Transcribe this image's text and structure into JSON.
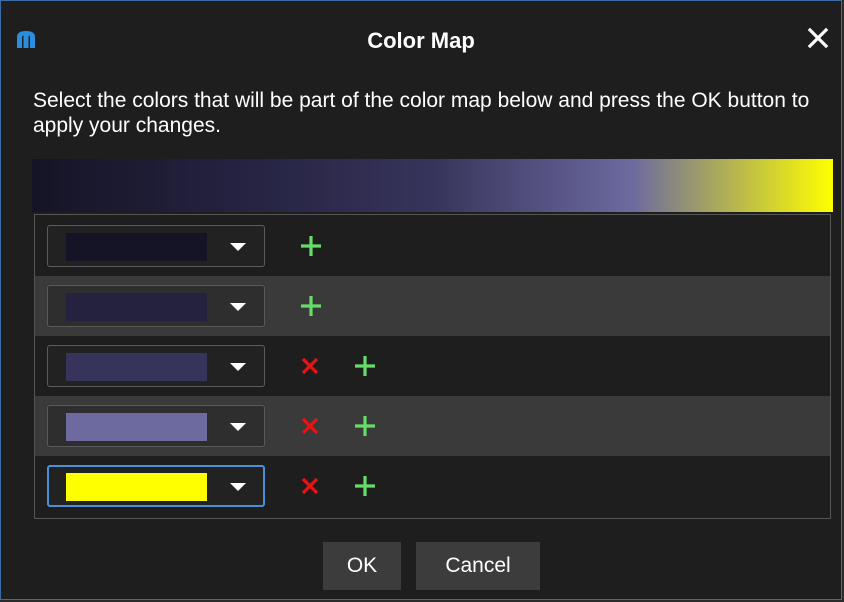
{
  "dialog": {
    "title": "Color Map",
    "app_icon": "app-logo-icon",
    "close_icon": "close-icon",
    "description": "Select the colors that will be part of the color map below and press the OK button to apply your changes."
  },
  "colors": {
    "accent": "#4a90d9",
    "remove": "#ee1111",
    "add": "#66dd66"
  },
  "color_stops": [
    {
      "color": "#151426",
      "removable": false
    },
    {
      "color": "#24223f",
      "removable": false
    },
    {
      "color": "#37345b",
      "removable": true
    },
    {
      "color": "#6c6a9f",
      "removable": true
    },
    {
      "color": "#ffff00",
      "removable": true
    }
  ],
  "footer": {
    "ok_label": "OK",
    "cancel_label": "Cancel"
  }
}
